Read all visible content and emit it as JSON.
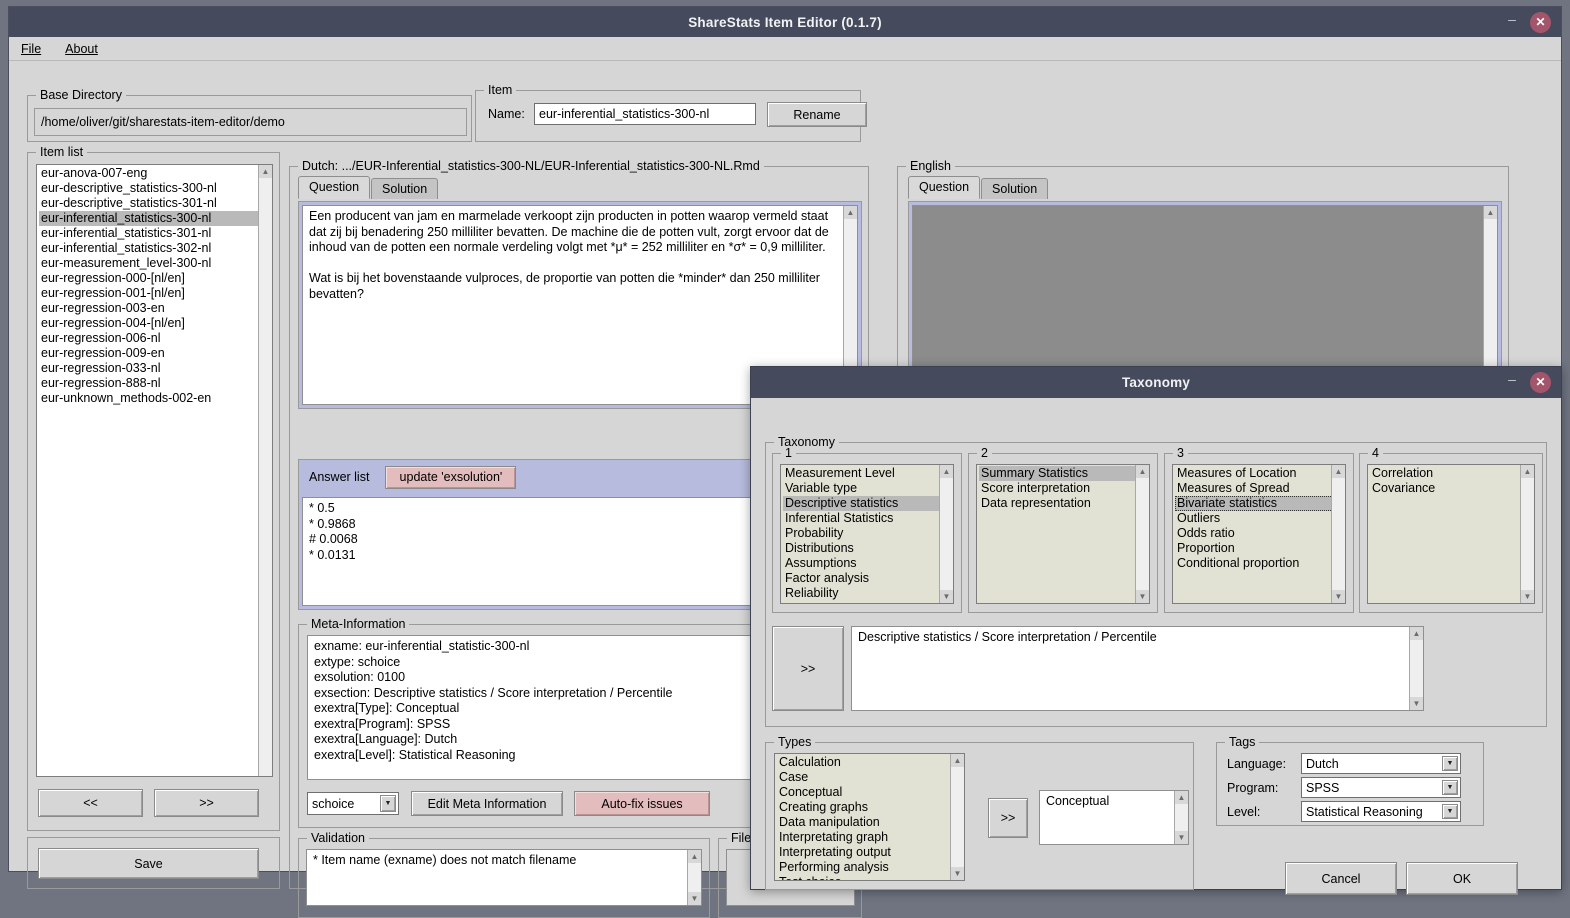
{
  "window": {
    "title": "ShareStats Item Editor (0.1.7)",
    "minimize": "–",
    "close": "✕"
  },
  "menu": {
    "file": "File",
    "about": "About"
  },
  "base_directory": {
    "legend": "Base Directory",
    "path": "/home/oliver/git/sharestats-item-editor/demo"
  },
  "item": {
    "legend": "Item",
    "name_label": "Name:",
    "name_value": "eur-inferential_statistics-300-nl",
    "rename_label": "Rename"
  },
  "item_list": {
    "legend": "Item list",
    "items": [
      "eur-anova-007-eng",
      "eur-descriptive_statistics-300-nl",
      "eur-descriptive_statistics-301-nl",
      "eur-inferential_statistics-300-nl",
      "eur-inferential_statistics-301-nl",
      "eur-inferential_statistics-302-nl",
      "eur-measurement_level-300-nl",
      "eur-regression-000-[nl/en]",
      "eur-regression-001-[nl/en]",
      "eur-regression-003-en",
      "eur-regression-004-[nl/en]",
      "eur-regression-006-nl",
      "eur-regression-009-en",
      "eur-regression-033-nl",
      "eur-regression-888-nl",
      "eur-unknown_methods-002-en"
    ],
    "selected_index": 3,
    "prev_label": "<<",
    "next_label": ">>",
    "save_label": "Save"
  },
  "dutch": {
    "legend": "Dutch:  .../EUR-Inferential_statistics-300-NL/EUR-Inferential_statistics-300-NL.Rmd",
    "tabs": [
      "Question",
      "Solution"
    ],
    "active_tab": 0,
    "question_text": "Een producent van jam en marmelade verkoopt zijn producten in potten waarop vermeld staat dat zij bij benadering 250 milliliter bevatten. De machine die de potten vult, zorgt ervoor dat de inhoud van de potten een normale verdeling volgt met *μ* = 252 milliliter en *σ* = 0,9 milliliter.\n\nWat is bij het bovenstaande vulproces, de proportie van potten die *minder* dan 250 milliliter bevatten?"
  },
  "answer_list": {
    "label": "Answer list",
    "update_button": "update 'exsolution'",
    "text": "* 0.5\n* 0.9868\n# 0.0068\n* 0.0131"
  },
  "meta": {
    "legend": "Meta-Information",
    "text": "exname: eur-inferential_statistic-300-nl\nextype: schoice\nexsolution: 0100\nexsection: Descriptive statistics / Score interpretation / Percentile\nexextra[Type]: Conceptual\nexextra[Program]: SPSS\nexextra[Language]: Dutch\nexextra[Level]: Statistical Reasoning",
    "type_combo_value": "schoice",
    "edit_meta_label": "Edit Meta Information",
    "autofix_label": "Auto-fix issues"
  },
  "validation": {
    "legend": "Validation",
    "text": "* Item name (exname) does not match filename"
  },
  "files": {
    "legend": "Files"
  },
  "english": {
    "legend": "English",
    "tabs": [
      "Question",
      "Solution"
    ],
    "active_tab": 0,
    "question_text": ""
  },
  "taxonomy_dialog": {
    "title": "Taxonomy",
    "minimize": "–",
    "close": "✕",
    "legend": "Taxonomy",
    "columns": [
      {
        "legend": "1",
        "items": [
          "Measurement Level",
          "Variable type",
          "Descriptive statistics",
          "Inferential Statistics",
          "Probability",
          "Distributions",
          "Assumptions",
          "Factor analysis",
          "Reliability"
        ],
        "selected_index": 2
      },
      {
        "legend": "2",
        "items": [
          "Summary Statistics",
          "Score interpretation",
          "Data representation"
        ],
        "selected_index": 0
      },
      {
        "legend": "3",
        "items": [
          "Measures of Location",
          "Measures of Spread",
          "Bivariate statistics",
          "Outliers",
          "Odds ratio",
          "Proportion",
          "Conditional proportion"
        ],
        "selected_index": 2
      },
      {
        "legend": "4",
        "items": [
          "Correlation",
          "Covariance"
        ],
        "selected_index": -1
      }
    ],
    "add_taxonomy_button": ">>",
    "selected_taxonomy": "Descriptive statistics / Score interpretation / Percentile",
    "types": {
      "legend": "Types",
      "items": [
        "Calculation",
        "Case",
        "Conceptual",
        "Creating graphs",
        "Data manipulation",
        "Interpretating graph",
        "Interpretating output",
        "Performing analysis",
        "Test choice"
      ],
      "selected_index": -1,
      "add_button": ">>",
      "chosen": "Conceptual"
    },
    "tags": {
      "legend": "Tags",
      "rows": [
        {
          "label": "Language:",
          "value": "Dutch"
        },
        {
          "label": "Program:",
          "value": "SPSS"
        },
        {
          "label": "Level:",
          "value": "Statistical Reasoning"
        }
      ]
    },
    "cancel_label": "Cancel",
    "ok_label": "OK"
  }
}
